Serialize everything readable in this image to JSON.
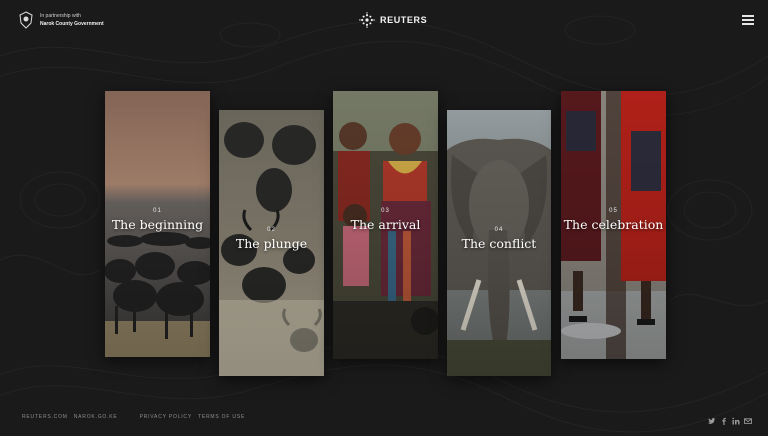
{
  "header": {
    "partner_small": "In partnership with",
    "partner_name": "Narok County Government",
    "brand": "REUTERS",
    "icons": [
      "county-emblem-icon",
      "reuters-logo-icon",
      "hamburger-menu-icon"
    ]
  },
  "chapters": [
    {
      "number": "01",
      "title": "The beginning"
    },
    {
      "number": "02",
      "title": "The plunge"
    },
    {
      "number": "03",
      "title": "The arrival"
    },
    {
      "number": "04",
      "title": "The conflict"
    },
    {
      "number": "05",
      "title": "The celebration"
    }
  ],
  "footer": {
    "links": [
      "REUTERS.COM",
      "NAROK.GO.KE",
      "PRIVACY POLICY",
      "TERMS OF USE"
    ],
    "social": [
      "twitter-icon",
      "facebook-icon",
      "linkedin-icon",
      "email-icon"
    ]
  },
  "colors": {
    "background": "#1a1a1b",
    "text": "#ffffff",
    "footer_text": "#8e8e8e"
  }
}
